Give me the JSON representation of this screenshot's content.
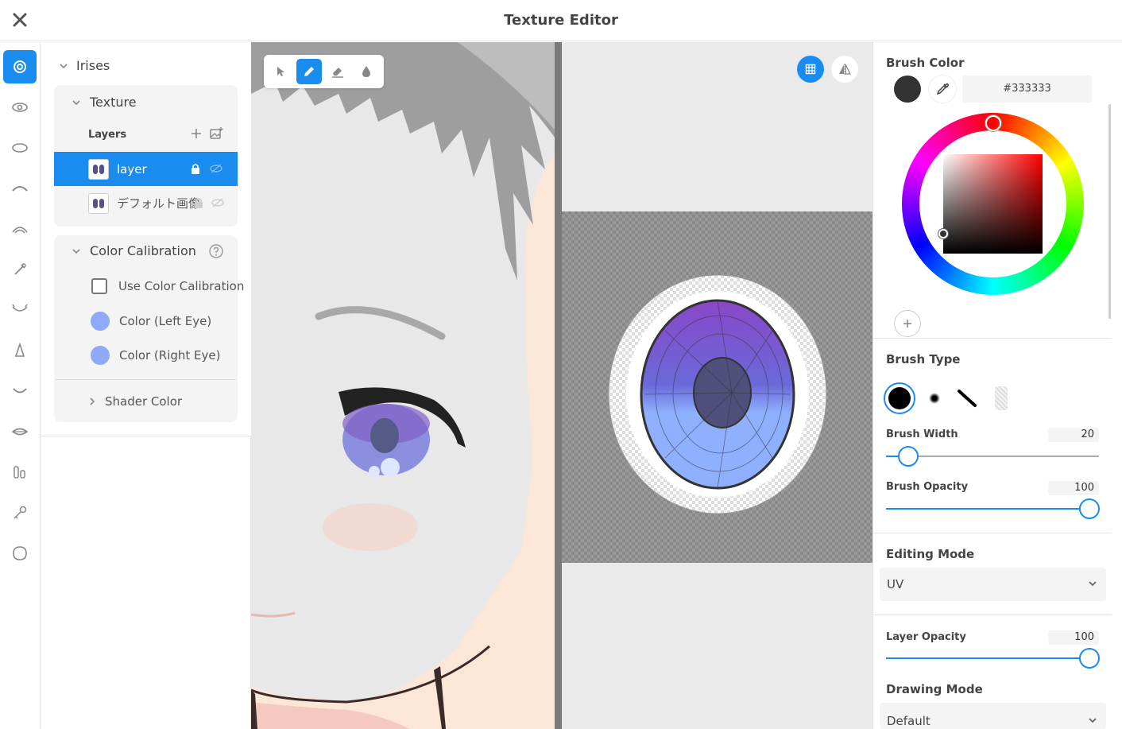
{
  "window": {
    "title": "Texture Editor"
  },
  "icons": {
    "close": "close-icon",
    "sidebar": [
      "iris-icon",
      "eye-icon",
      "eye-white-icon",
      "eyelash-icon",
      "eyebrow-icon",
      "brush-icon",
      "lower-lash-icon",
      "nose-icon",
      "mouth-icon",
      "lips-icon",
      "teeth-icon",
      "key-icon",
      "face-outline-icon"
    ]
  },
  "panel": {
    "section": "Irises",
    "texture": {
      "title": "Texture",
      "layers_label": "Layers",
      "layers": [
        {
          "name": "layer",
          "selected": true
        },
        {
          "name": "デフォルト画像",
          "selected": false
        }
      ]
    },
    "calibration": {
      "title": "Color Calibration",
      "use_label": "Use Color Calibration",
      "left_eye": "Color (Left Eye)",
      "right_eye": "Color (Right Eye)",
      "left_color": "#8eaaf8",
      "right_color": "#8eaaf8"
    },
    "shader": {
      "title": "Shader Color"
    }
  },
  "toolbar": {
    "tools": [
      "select-tool",
      "pen-tool",
      "eraser-tool",
      "fill-tool"
    ],
    "active": "pen-tool"
  },
  "uv_view": {
    "buttons": [
      "grid-toggle",
      "mirror-toggle"
    ]
  },
  "brush": {
    "color_label": "Brush Color",
    "color_hex": "#333333",
    "type_label": "Brush Type",
    "width_label": "Brush Width",
    "width_value": "20",
    "width_fraction": 0.1,
    "opacity_label": "Brush Opacity",
    "opacity_value": "100",
    "opacity_fraction": 1.0
  },
  "editing_mode": {
    "label": "Editing Mode",
    "value": "UV"
  },
  "layer_opacity": {
    "label": "Layer Opacity",
    "value": "100",
    "fraction": 1.0
  },
  "drawing_mode": {
    "label": "Drawing Mode",
    "value": "Default"
  },
  "colors": {
    "accent": "#1a8cf0"
  }
}
